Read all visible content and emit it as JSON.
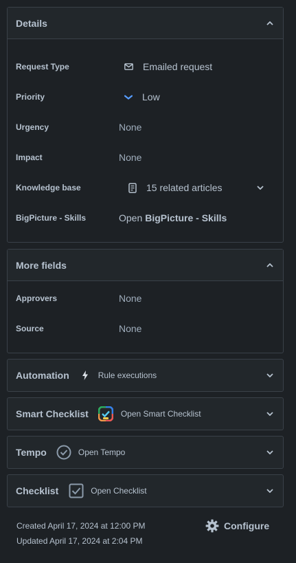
{
  "details": {
    "title": "Details",
    "rows": [
      {
        "label": "Request Type",
        "value": "Emailed request",
        "icon": "mail-icon"
      },
      {
        "label": "Priority",
        "value": "Low",
        "icon": "chevron-low-priority-icon"
      },
      {
        "label": "Urgency",
        "value": "None"
      },
      {
        "label": "Impact",
        "value": "None"
      },
      {
        "label": "Knowledge base",
        "value": "15 related articles",
        "icon": "article-icon"
      },
      {
        "label": "BigPicture - Skills",
        "value_prefix": "Open",
        "value_bold": "BigPicture - Skills"
      }
    ]
  },
  "more_fields": {
    "title": "More fields",
    "rows": [
      {
        "label": "Approvers",
        "value": "None"
      },
      {
        "label": "Source",
        "value": "None"
      }
    ]
  },
  "automation": {
    "title": "Automation",
    "sub": "Rule executions",
    "icon": "lightning-icon"
  },
  "smart_checklist": {
    "title": "Smart Checklist",
    "sub": "Open Smart Checklist",
    "icon": "smart-checklist-icon"
  },
  "tempo": {
    "title": "Tempo",
    "sub": "Open Tempo",
    "icon": "tempo-check-circle-icon"
  },
  "checklist": {
    "title": "Checklist",
    "sub": "Open Checklist",
    "icon": "checkbox-icon"
  },
  "footer": {
    "created": "Created April 17, 2024 at 12:00 PM",
    "updated": "Updated April 17, 2024 at 2:04 PM",
    "configure": "Configure"
  },
  "colors": {
    "priority_low": "#579dff",
    "background": "#1d2125",
    "panel_header": "#22272b",
    "border": "#3a4149"
  }
}
